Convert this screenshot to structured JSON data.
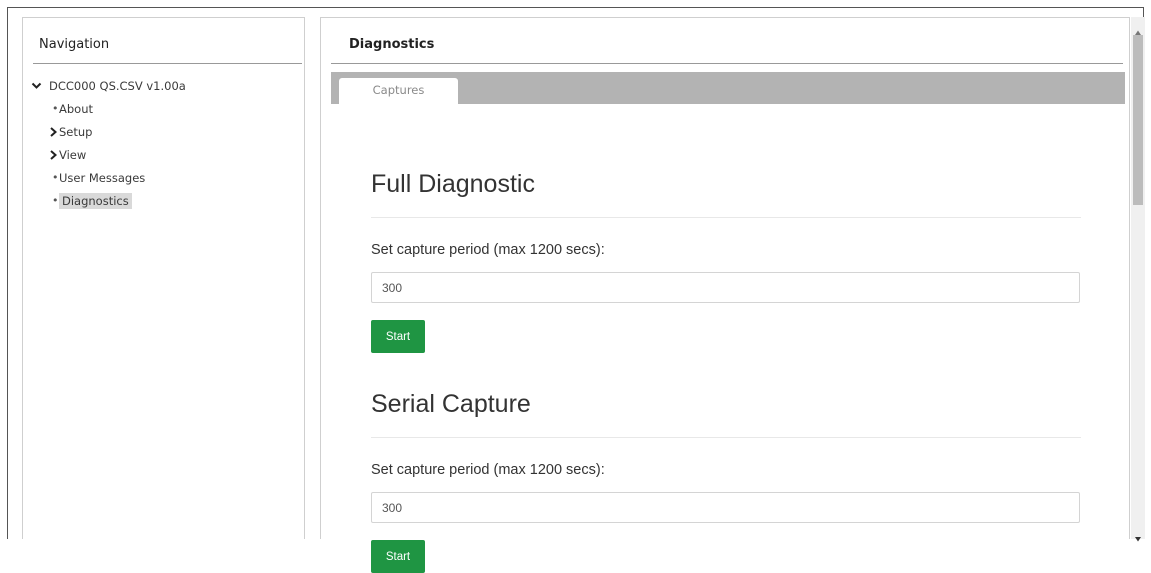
{
  "navigation": {
    "title": "Navigation",
    "tree": {
      "root_label": "DCC000 QS.CSV v1.00a",
      "items": [
        {
          "label": "About",
          "type": "leaf"
        },
        {
          "label": "Setup",
          "type": "folder"
        },
        {
          "label": "View",
          "type": "folder"
        },
        {
          "label": "User Messages",
          "type": "leaf"
        },
        {
          "label": "Diagnostics",
          "type": "leaf",
          "selected": true
        }
      ]
    }
  },
  "main": {
    "title": "Diagnostics",
    "tabs": [
      {
        "label": "Captures",
        "active": true
      }
    ],
    "sections": [
      {
        "title": "Full Diagnostic",
        "field_label": "Set capture period (max 1200 secs):",
        "input_value": "300",
        "button_label": "Start"
      },
      {
        "title": "Serial Capture",
        "field_label": "Set capture period (max 1200 secs):",
        "input_value": "300",
        "button_label": "Start"
      }
    ]
  },
  "colors": {
    "start_button": "#1f9543",
    "tab_bar": "#b3b3b3",
    "selected_item": "#d9d9d9"
  },
  "icons": {
    "expanded": "chevron-down-icon",
    "collapsed": "chevron-right-icon",
    "leaf": "bullet-icon"
  }
}
